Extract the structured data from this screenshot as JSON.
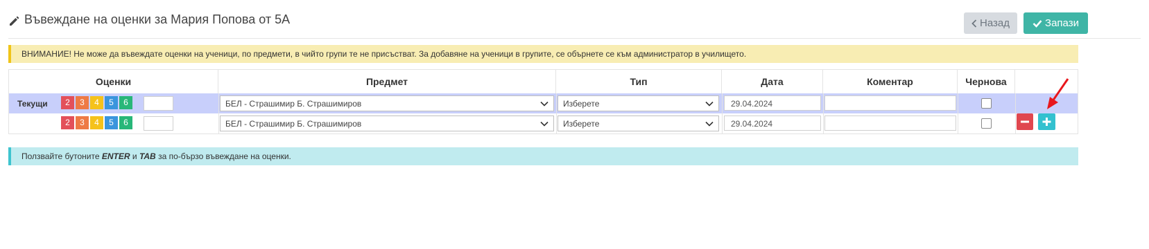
{
  "header": {
    "title": "Въвеждане на оценки за Мария Попова от 5А",
    "back_label": "Назад",
    "save_label": "Запази"
  },
  "warning": "ВНИМАНИЕ! Не може да въвеждате оценки на ученици, по предмети, в чийто групи те не присъстват. За добавяне на ученици в групите, се обърнете се към администратор в училището.",
  "table": {
    "columns": [
      "Оценки",
      "Предмет",
      "Тип",
      "Дата",
      "Коментар",
      "Чернова"
    ],
    "current_label": "Текущи",
    "grade_buttons": [
      "2",
      "3",
      "4",
      "5",
      "6"
    ],
    "rows": [
      {
        "grade_value": "",
        "subject": "БЕЛ - Страшимир Б. Страшимиров",
        "type": "Изберете",
        "date": "29.04.2024",
        "comment": "",
        "draft": false
      },
      {
        "grade_value": "",
        "subject": "БЕЛ - Страшимир Б. Страшимиров",
        "type": "Изберете",
        "date": "29.04.2024",
        "comment": "",
        "draft": false
      }
    ]
  },
  "info": {
    "prefix": "Ползвайте бутоните",
    "key1": "ENTER",
    "conj": "и",
    "key2": "TAB",
    "suffix": "за по-бързо въвеждане на оценки."
  },
  "colors": {
    "save": "#3fb5a6",
    "back": "#d7dbe0",
    "current_row": "#c8cffb",
    "warning_bg": "#f8edb3",
    "info_bg": "#c0ebef",
    "minus": "#e0474f",
    "plus": "#33c1cf",
    "arrow": "#e8171c"
  }
}
